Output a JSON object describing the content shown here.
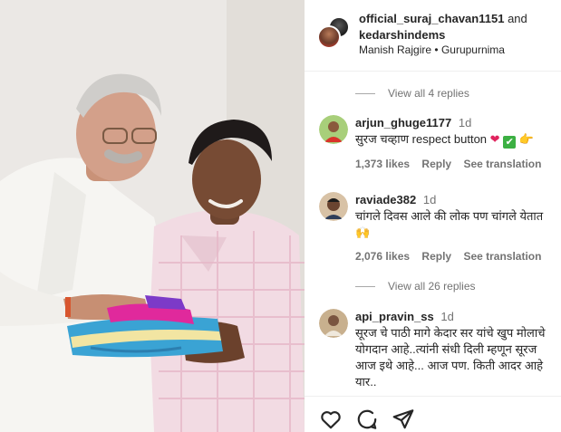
{
  "post": {
    "author1": "official_suraj_chavan1151",
    "and_text": "and",
    "author2": "kedarshindems",
    "music": "Manish Rajgire",
    "separator": "•",
    "location": "Gurupurnima"
  },
  "thread1": {
    "view_replies": "View all 4 replies"
  },
  "comments": [
    {
      "username": "arjun_ghuge1177",
      "time": "1d",
      "text": "सुरज चव्हाण respect button",
      "likes": "1,373 likes",
      "reply": "Reply",
      "translate": "See translation"
    },
    {
      "username": "raviade382",
      "time": "1d",
      "text": "चांगले दिवस आले की लोक पण चांगले येतात",
      "likes": "2,076 likes",
      "reply": "Reply",
      "translate": "See translation"
    },
    {
      "username": "api_pravin_ss",
      "time": "1d",
      "text": "सूरज चे पाठी मागे केदार सर यांचे खुप मोलाचे योगदान आहे..त्यांनी संधी दिली म्हणून सूरज आज इथे आहे... आज पण. किती आदर आहे यार.."
    }
  ],
  "thread2": {
    "view_replies": "View all 26 replies"
  },
  "emoji": {
    "heart": "❤",
    "check": "✔",
    "pointing_hand": "👉",
    "hands": "🙌"
  },
  "icons": [
    "heart-icon",
    "comment-icon",
    "share-icon"
  ],
  "colors": {
    "muted": "#737373",
    "text": "#262626",
    "divider": "#efefef"
  }
}
